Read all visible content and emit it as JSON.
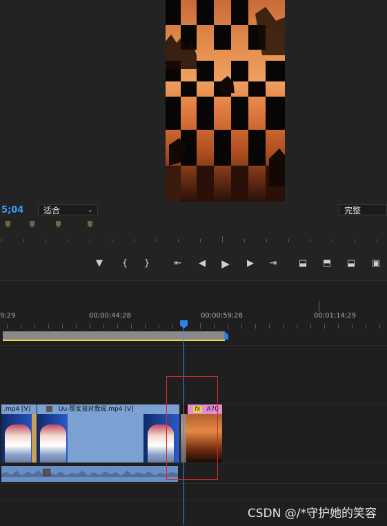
{
  "monitor": {
    "timecode": "5;04",
    "fit_label": "适合",
    "full_label": "完整"
  },
  "transport": {
    "buttons": [
      "add-marker",
      "mark-in",
      "mark-out",
      "go-to-in",
      "step-back",
      "play",
      "step-forward",
      "go-to-out",
      "lift",
      "extract",
      "insert",
      "export-frame"
    ]
  },
  "timeline": {
    "ruler_times": [
      "9;29",
      "00;00;44;28",
      "00;00;59;28",
      "00;01;14;29"
    ],
    "clips": {
      "clip1_label": ".mp4 [V]",
      "clip2_label": "Uu-那女孩对我说.mp4 [V]",
      "clip3_fx": "fx",
      "clip3_label": "A70"
    }
  },
  "watermark": "CSDN @/*守护她的笑容",
  "colors": {
    "accent_blue": "#3d9bff",
    "clip_blue": "#7ba0d2",
    "clip_pink": "#e48bd3",
    "highlight_red": "#d42a2a",
    "work_area_yellow": "#e7d83b"
  }
}
